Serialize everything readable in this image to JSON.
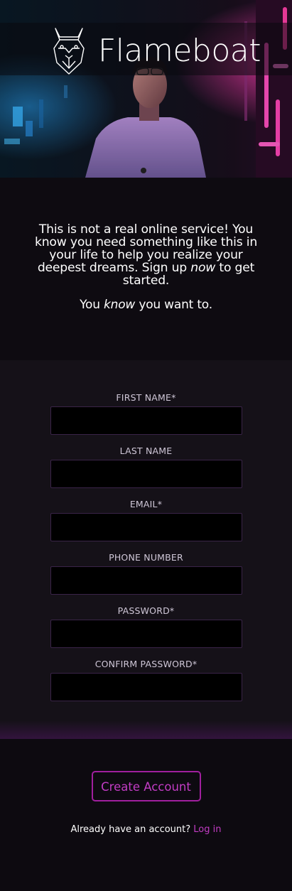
{
  "brand": {
    "name": "Flameboat",
    "logo_icon": "dog-head-icon"
  },
  "intro": {
    "part1": "This is not a real online service! You know you need something like this in your life to help you realize your deepest dreams. Sign up ",
    "emphasis1": "now",
    "part2": " to get started.",
    "tag_prefix": "You ",
    "tag_emphasis": "know",
    "tag_suffix": " you want to."
  },
  "form": {
    "fields": [
      {
        "label": "FIRST NAME*",
        "value": ""
      },
      {
        "label": "LAST NAME",
        "value": ""
      },
      {
        "label": "EMAIL*",
        "value": ""
      },
      {
        "label": "PHONE NUMBER",
        "value": ""
      },
      {
        "label": "PASSWORD*",
        "value": ""
      },
      {
        "label": "CONFIRM PASSWORD*",
        "value": ""
      }
    ]
  },
  "footer": {
    "create_button": "Create Account",
    "login_prompt": "Already have an account?",
    "login_link": "Log in"
  },
  "colors": {
    "accent": "#c23cc4",
    "accent_border": "#a01f9e",
    "form_bg": "#151118",
    "page_bg": "#0d0a10"
  }
}
